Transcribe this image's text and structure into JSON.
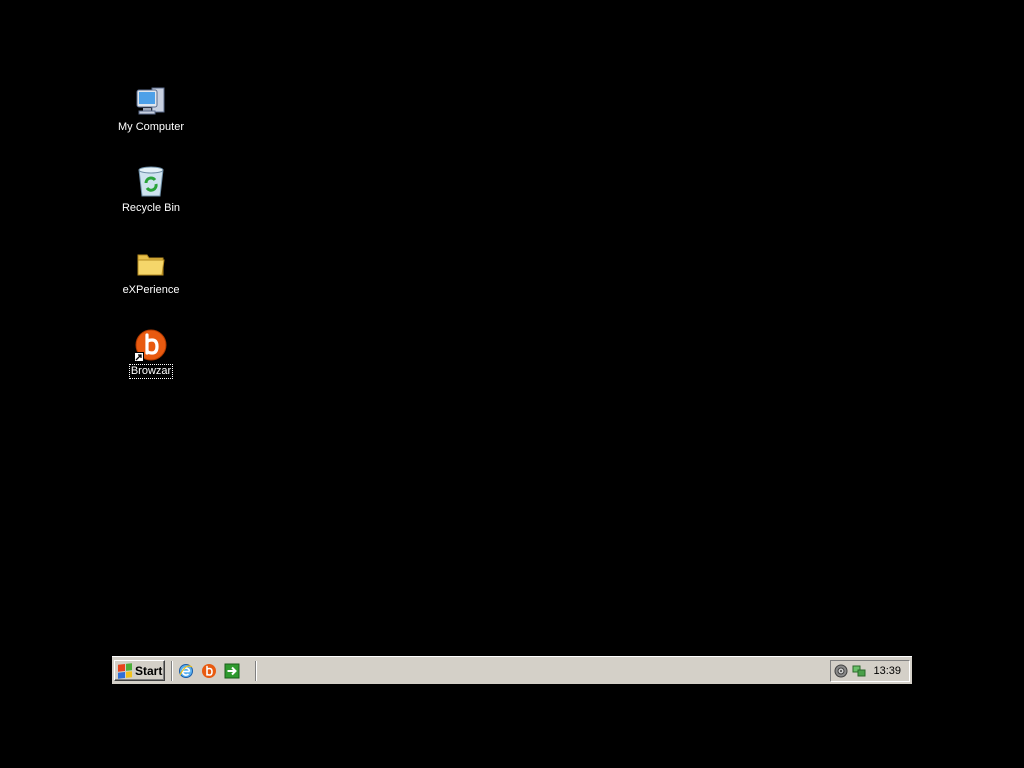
{
  "desktop": {
    "background_color": "#000000",
    "icons": [
      {
        "label": "My Computer",
        "icon": "my-computer-icon"
      },
      {
        "label": "Recycle Bin",
        "icon": "recycle-bin-icon"
      },
      {
        "label": "eXPerience",
        "icon": "folder-icon"
      },
      {
        "label": "Browzar",
        "icon": "browzar-icon",
        "shortcut": true,
        "selected": true
      }
    ]
  },
  "taskbar": {
    "start_label": "Start",
    "quick_launch": [
      {
        "icon": "internet-explorer-icon"
      },
      {
        "icon": "browzar-icon"
      },
      {
        "icon": "green-arrow-icon"
      }
    ],
    "tray": {
      "icons": [
        {
          "icon": "speaker-icon"
        },
        {
          "icon": "network-icon"
        }
      ],
      "clock": "13:39"
    }
  },
  "colors": {
    "taskbar": "#d4d0c8",
    "browzar_orange": "#e85a10",
    "folder_yellow": "#f5d66a"
  }
}
